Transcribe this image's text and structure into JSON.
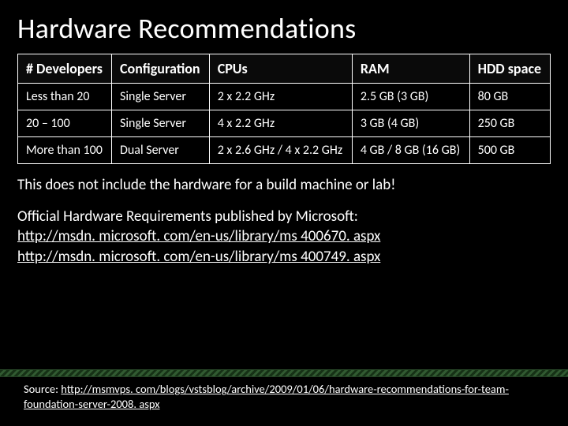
{
  "title": "Hardware Recommendations",
  "table": {
    "headers": [
      "# Developers",
      "Configuration",
      "CPUs",
      "RAM",
      "HDD space"
    ],
    "rows": [
      [
        "Less than 20",
        "Single Server",
        "2 x 2.2 GHz",
        "2.5 GB (3 GB)",
        "80 GB"
      ],
      [
        "20 – 100",
        "Single Server",
        "4 x 2.2 GHz",
        "3 GB (4 GB)",
        "250 GB"
      ],
      [
        "More than 100",
        "Dual Server",
        "2 x 2.6 GHz / 4 x 2.2 GHz",
        "4 GB / 8 GB (16 GB)",
        "500 GB"
      ]
    ]
  },
  "note": "This does not include the hardware for a build machine or lab!",
  "official_label": "Official Hardware Requirements published by Microsoft:",
  "official_links": [
    "http://msdn. microsoft. com/en-us/library/ms 400670. aspx",
    "http://msdn. microsoft. com/en-us/library/ms 400749. aspx"
  ],
  "source_label": "Source: ",
  "source_link": "http://msmvps. com/blogs/vstsblog/archive/2009/01/06/hardware-recommendations-for-team-foundation-server-2008. aspx"
}
